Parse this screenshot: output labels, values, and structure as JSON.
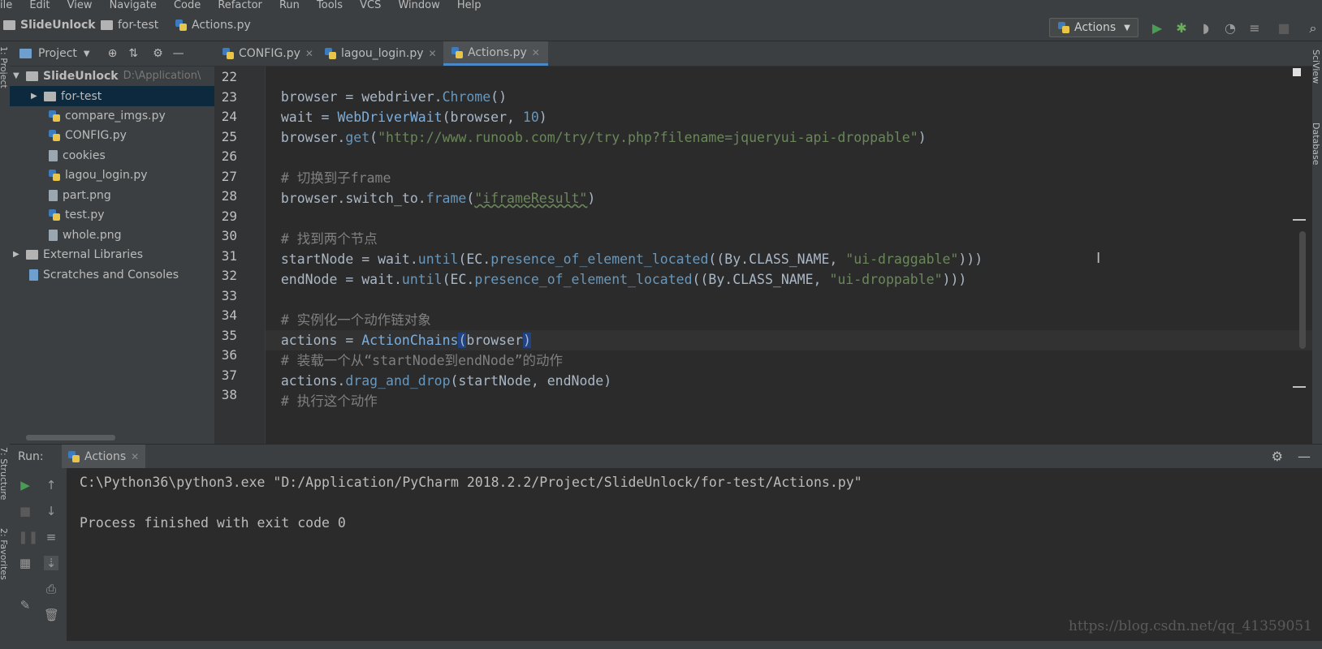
{
  "menu": [
    "ile",
    "Edit",
    "View",
    "Navigate",
    "Code",
    "Refactor",
    "Run",
    "Tools",
    "VCS",
    "Window",
    "Help"
  ],
  "breadcrumb": {
    "project": "SlideUnlock",
    "folder": "for-test",
    "file": "Actions.py"
  },
  "run_config": {
    "label": "Actions",
    "arrow": "▼"
  },
  "toolbar_icons": [
    "run-icon",
    "debug-icon",
    "coverage-icon",
    "profile-icon",
    "concurrency-icon",
    "stop-icon",
    "search-icon"
  ],
  "side_strip": {
    "left_top": "1: Project",
    "left_bottom_1": "7: Structure",
    "left_bottom_2": "2: Favorites",
    "right_1": "SciView",
    "right_2": "Database"
  },
  "project_panel": {
    "title": "Project",
    "root": {
      "name": "SlideUnlock",
      "path": "D:\\Application\\"
    },
    "items": [
      {
        "label": "for-test",
        "kind": "folder"
      },
      {
        "label": "compare_imgs.py",
        "kind": "py"
      },
      {
        "label": "CONFIG.py",
        "kind": "py"
      },
      {
        "label": "cookies",
        "kind": "file"
      },
      {
        "label": "lagou_login.py",
        "kind": "py"
      },
      {
        "label": "part.png",
        "kind": "file"
      },
      {
        "label": "test.py",
        "kind": "py"
      },
      {
        "label": "whole.png",
        "kind": "file"
      }
    ],
    "external": "External Libraries",
    "scratches": "Scratches and Consoles"
  },
  "tabs": [
    {
      "label": "CONFIG.py"
    },
    {
      "label": "lagou_login.py"
    },
    {
      "label": "Actions.py"
    }
  ],
  "code": {
    "numbers": [
      "22",
      "23",
      "24",
      "25",
      "26",
      "27",
      "28",
      "29",
      "30",
      "31",
      "32",
      "33",
      "34",
      "35",
      "36",
      "37",
      "38"
    ],
    "l23": {
      "a": "browser",
      "b": " = webdriver.",
      "c": "Chrome",
      "d": "()"
    },
    "l24": {
      "a": "wait",
      "b": " = ",
      "c": "WebDriverWait",
      "d": "(browser, ",
      "e": "10",
      "f": ")"
    },
    "l25": {
      "a": "browser.",
      "b": "get",
      "c": "(",
      "d": "\"http://www.runoob.com/try/try.php?filename=jqueryui-api-droppable\"",
      "e": ")"
    },
    "l27": "# 切换到子frame",
    "l28": {
      "a": "browser.switch_to.",
      "b": "frame",
      "c": "(",
      "d": "\"iframeResult\"",
      "e": ")"
    },
    "l30": "# 找到两个节点",
    "l31": {
      "a": "startNode",
      "b": " = wait.",
      "c": "until",
      "d": "(EC.",
      "e": "presence_of_element_located",
      "f": "((By.CLASS_NAME, ",
      "g": "\"ui-draggable\"",
      "h": ")))"
    },
    "l32": {
      "a": "endNode",
      "b": " = wait.",
      "c": "until",
      "d": "(EC.",
      "e": "presence_of_element_located",
      "f": "((By.CLASS_NAME, ",
      "g": "\"ui-droppable\"",
      "h": ")))"
    },
    "l34": "# 实例化一个动作链对象",
    "l35": {
      "a": "actions",
      "b": " = ",
      "c": "ActionChains",
      "d": "(",
      "e": "browser",
      "f": ")"
    },
    "l36": "# 装载一个从“startNode到endNode”的动作",
    "l37": {
      "a": "actions.",
      "b": "drag_and_drop",
      "c": "(startNode, endNode)"
    },
    "l38": "# 执行这个动作"
  },
  "run_panel": {
    "label": "Run:",
    "tab": "Actions",
    "command": "C:\\Python36\\python3.exe \"D:/Application/PyCharm 2018.2.2/Project/SlideUnlock/for-test/Actions.py\"",
    "result": "Process finished with exit code 0"
  },
  "watermark": "https://blog.csdn.net/qq_41359051",
  "colors": {
    "accent": "#4a88c7",
    "keyword_call": "#6897bb",
    "string": "#6a8759",
    "comment": "#808080",
    "run_green": "#499c54"
  }
}
